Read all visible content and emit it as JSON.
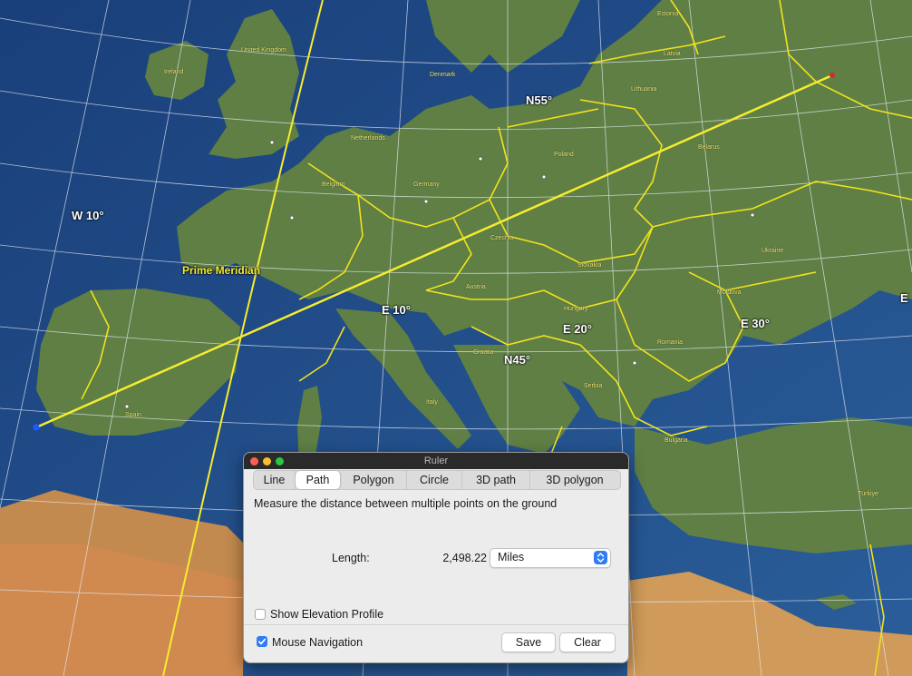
{
  "map": {
    "countries": {
      "estonia": "Estonia",
      "latvia": "Latvia",
      "lithuania": "Lithuania",
      "united_kingdom": "United Kingdom",
      "ireland": "Ireland",
      "denmark": "Denmark",
      "netherlands": "Netherlands",
      "belgium": "Belgium",
      "germany": "Germany",
      "poland": "Poland",
      "belarus": "Belarus",
      "czechia": "Czechia",
      "slovakia": "Slovakia",
      "ukraine": "Ukraine",
      "austria": "Austria",
      "hungary": "Hungary",
      "moldova": "Moldova",
      "romania": "Romania",
      "croatia": "Croatia",
      "serbia": "Serbia",
      "italy": "Italy",
      "spain": "Spain",
      "bulgaria": "Bulgaria",
      "turkiye": "Türkiye"
    },
    "grid_labels": {
      "n55": "N55°",
      "n45": "N45°",
      "w10": "W 10°",
      "e10": "E 10°",
      "e20": "E 20°",
      "e30": "E 30°",
      "e_edge": "E"
    },
    "prime_meridian": "Prime Meridian"
  },
  "ruler": {
    "title": "Ruler",
    "tabs": [
      "Line",
      "Path",
      "Polygon",
      "Circle",
      "3D path",
      "3D polygon"
    ],
    "selected_tab": "Path",
    "description": "Measure the distance between multiple points on the ground",
    "length_label": "Length:",
    "length_value": "2,498.22",
    "unit": "Miles",
    "show_elevation_label": "Show Elevation Profile",
    "show_elevation_checked": false,
    "mouse_nav_label": "Mouse Navigation",
    "mouse_nav_checked": true,
    "save_label": "Save",
    "clear_label": "Clear"
  },
  "colors": {
    "accent": "#2f7cf6",
    "path_line": "#f6ec2f",
    "border_line": "#f2e21c",
    "sea": "#1f4f8f",
    "land": "#5f7f45"
  }
}
